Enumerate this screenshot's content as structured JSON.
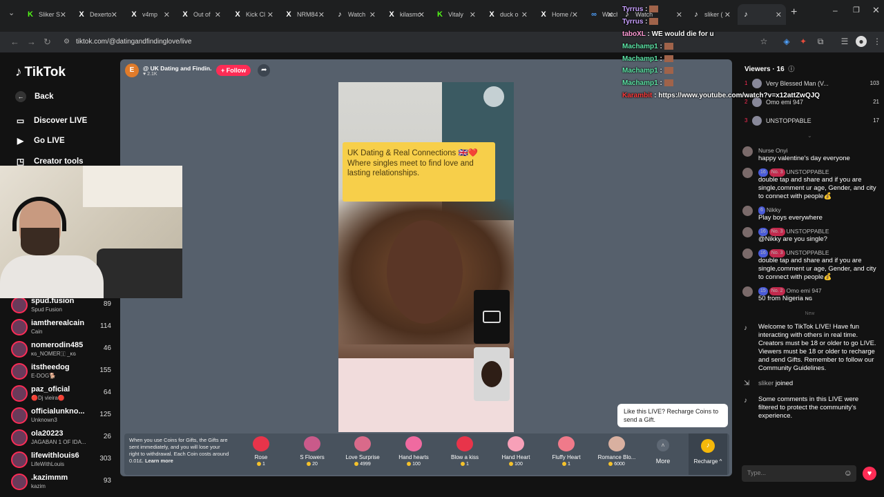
{
  "browser": {
    "tabs": [
      {
        "label": "Sliker S",
        "fav": "K",
        "favColor": "#53fc18"
      },
      {
        "label": "Dexerto",
        "fav": "X",
        "favColor": "#ffffff"
      },
      {
        "label": "v4mp",
        "fav": "X",
        "favColor": "#ffffff"
      },
      {
        "label": "Out of",
        "fav": "X",
        "favColor": "#ffffff"
      },
      {
        "label": "Kick Cl",
        "fav": "X",
        "favColor": "#ffffff"
      },
      {
        "label": "NRM84",
        "fav": "X",
        "favColor": "#ffffff"
      },
      {
        "label": "Watch",
        "fav": "♪",
        "favColor": "#ffffff"
      },
      {
        "label": "kilasmc",
        "fav": "X",
        "favColor": "#ffffff"
      },
      {
        "label": "Vitaly",
        "fav": "K",
        "favColor": "#53fc18"
      },
      {
        "label": "duck o",
        "fav": "X",
        "favColor": "#ffffff"
      },
      {
        "label": "Home /",
        "fav": "X",
        "favColor": "#ffffff"
      },
      {
        "label": "Watch",
        "fav": "∞",
        "favColor": "#4ea1ff"
      },
      {
        "label": "Watch",
        "fav": "♪",
        "favColor": "#ffffff"
      },
      {
        "label": "sliker (",
        "fav": "♪",
        "favColor": "#ffffff"
      },
      {
        "label": "",
        "fav": "♪",
        "favColor": "#ffffff"
      }
    ],
    "url": "tiktok.com/@datingandfindinglove/live"
  },
  "tiktok": {
    "logo": "TikTok",
    "back": "Back",
    "nav": [
      "Discover LIVE",
      "Go LIVE",
      "Creator tools"
    ],
    "lives": [
      {
        "name": "spud.fusion",
        "sub": "Spud Fusion",
        "count": "89"
      },
      {
        "name": "iamtherealcain",
        "sub": "Cain",
        "count": "114"
      },
      {
        "name": "nomerodin485",
        "sub": "ᴋɢ_NOMER🇮 _ᴋɢ",
        "count": "46"
      },
      {
        "name": "itstheedog",
        "sub": "E-DOG🐕",
        "count": "155"
      },
      {
        "name": "paz_oficial",
        "sub": "🔴Dj vieira🔴",
        "count": "64"
      },
      {
        "name": "officialunkno...",
        "sub": "Unknown3",
        "count": "125"
      },
      {
        "name": "ola20223",
        "sub": "JAGABAN 1 OF IDA...",
        "count": "26"
      },
      {
        "name": "lifewithlouis6",
        "sub": "LifeWithLouis",
        "count": "303"
      },
      {
        "name": ".kazimmm",
        "sub": "kazim",
        "count": "93"
      }
    ]
  },
  "stream": {
    "avatar_letter": "E",
    "title": "@ UK Dating and Findin...",
    "likes": "2.1K",
    "follow": "+ Follow",
    "banner": "UK Dating & Real Connections 🇬🇧❤️ Where singles meet to find love and lasting relationships.",
    "tooltip": "Like this LIVE? Recharge Coins to send a Gift."
  },
  "gifts": {
    "notice": "When you use Coins for Gifts, the Gifts are sent immediately, and you will lose your right to withdrawal. Each Coin costs around 0.01£.",
    "learn_more": "Learn more",
    "items": [
      {
        "name": "Rose",
        "price": "1",
        "color": "#e8344a"
      },
      {
        "name": "S Flowers",
        "price": "20",
        "color": "#c95a8a"
      },
      {
        "name": "Love Surprise",
        "price": "4999",
        "color": "#d96a8a"
      },
      {
        "name": "Hand hearts",
        "price": "100",
        "color": "#f06aa0"
      },
      {
        "name": "Blow a kiss",
        "price": "1",
        "color": "#e8344a"
      },
      {
        "name": "Hand Heart",
        "price": "100",
        "color": "#f7a0b8"
      },
      {
        "name": "Fluffy Heart",
        "price": "1",
        "color": "#f07a8a"
      },
      {
        "name": "Romance Blo...",
        "price": "6000",
        "color": "#d9b0a0"
      }
    ],
    "more": "More",
    "recharge": "Recharge ^"
  },
  "viewers": {
    "title": "Viewers · 16",
    "list": [
      {
        "rank": "1",
        "name": "Very Blessed Man (V...",
        "score": "103"
      },
      {
        "rank": "2",
        "name": "Omo emi 947",
        "score": "21"
      },
      {
        "rank": "3",
        "name": "UNSTOPPABLE",
        "score": "17"
      }
    ]
  },
  "chat": [
    {
      "user": "Nurse Onyi",
      "text": "happy valentine's day everyone",
      "badges": []
    },
    {
      "user": "UNSTOPPABLE",
      "text": "double tap and share and if you are single,comment ur age, Gender, and city to connect with people💰",
      "badges": [
        "16",
        "No. 3"
      ]
    },
    {
      "user": "Nikky",
      "text": "Play boys everywhere",
      "badges": [
        "6"
      ]
    },
    {
      "user": "UNSTOPPABLE",
      "text": "@Nikky are you single?",
      "badges": [
        "16",
        "No. 3"
      ]
    },
    {
      "user": "UNSTOPPABLE",
      "text": "double tap and share and if you are single,comment ur age, Gender, and city to connect with people💰",
      "badges": [
        "16",
        "No. 3"
      ]
    },
    {
      "user": "Omo emi 947",
      "text": "50 from Nigeria ɴɢ",
      "badges": [
        "15",
        "No. 2"
      ]
    }
  ],
  "chat_new": "New",
  "system": [
    {
      "text": "Welcome to TikTok LIVE! Have fun interacting with others in real time. Creators must be 18 or older to go LIVE. Viewers must be 18 or older to recharge and send Gifts. Remember to follow our Community Guidelines."
    },
    {
      "user": "sliker",
      "text": "joined"
    },
    {
      "text": "Some comments in this LIVE were filtered to protect the community's experience."
    }
  ],
  "chat_input_placeholder": "Type...",
  "overlay_chat": [
    {
      "user": "Tyrrus",
      "text": "",
      "color": "#c9a0ff"
    },
    {
      "user": "Tyrrus",
      "text": "",
      "color": "#c9a0ff"
    },
    {
      "user": "taboXL",
      "text": "WE would die for u",
      "color": "#ff9ad5"
    },
    {
      "user": "Machamp1",
      "text": "",
      "color": "#5ee6a8"
    },
    {
      "user": "Machamp1",
      "text": "",
      "color": "#5ee6a8"
    },
    {
      "user": "Machamp1",
      "text": "",
      "color": "#5ee6a8"
    },
    {
      "user": "Machamp1",
      "text": "",
      "color": "#5ee6a8"
    },
    {
      "user": "Karambit",
      "text": "https://www.youtube.com/watch?v=x12attZwQJQ",
      "color": "#ff3b3b"
    }
  ]
}
